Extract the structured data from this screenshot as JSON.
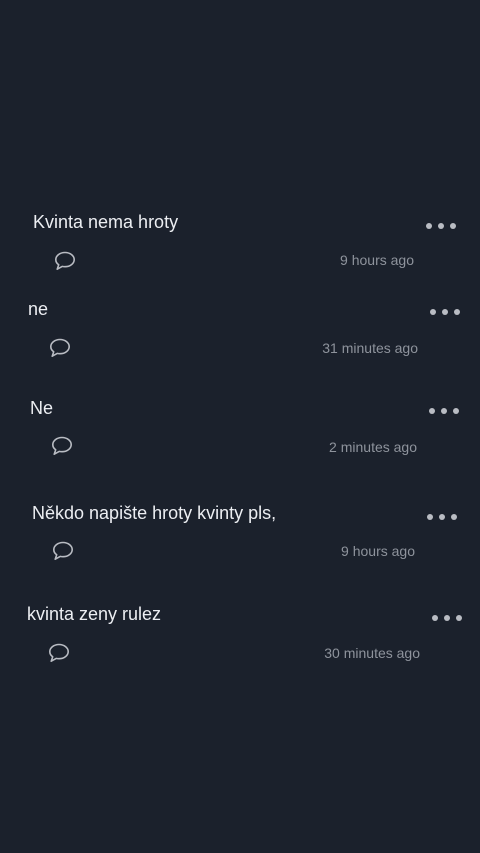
{
  "colors": {
    "background": "#1b212c",
    "text": "#eceef2",
    "muted": "#8e939c",
    "icon": "#b9bcc3"
  },
  "posts": [
    {
      "text": "Kvinta nema hroty",
      "time": "9 hours ago",
      "comment_icon": "comment-bubble-icon",
      "more_icon": "more-dots-icon"
    },
    {
      "text": "ne",
      "time": "31 minutes ago",
      "comment_icon": "comment-bubble-icon",
      "more_icon": "more-dots-icon"
    },
    {
      "text": "Ne",
      "time": "2 minutes ago",
      "comment_icon": "comment-bubble-icon",
      "more_icon": "more-dots-icon"
    },
    {
      "text": "Někdo napište hroty kvinty pls,",
      "time": "9 hours ago",
      "comment_icon": "comment-bubble-icon",
      "more_icon": "more-dots-icon"
    },
    {
      "text": "kvinta zeny rulez",
      "time": "30 minutes ago",
      "comment_icon": "comment-bubble-icon",
      "more_icon": "more-dots-icon"
    }
  ]
}
